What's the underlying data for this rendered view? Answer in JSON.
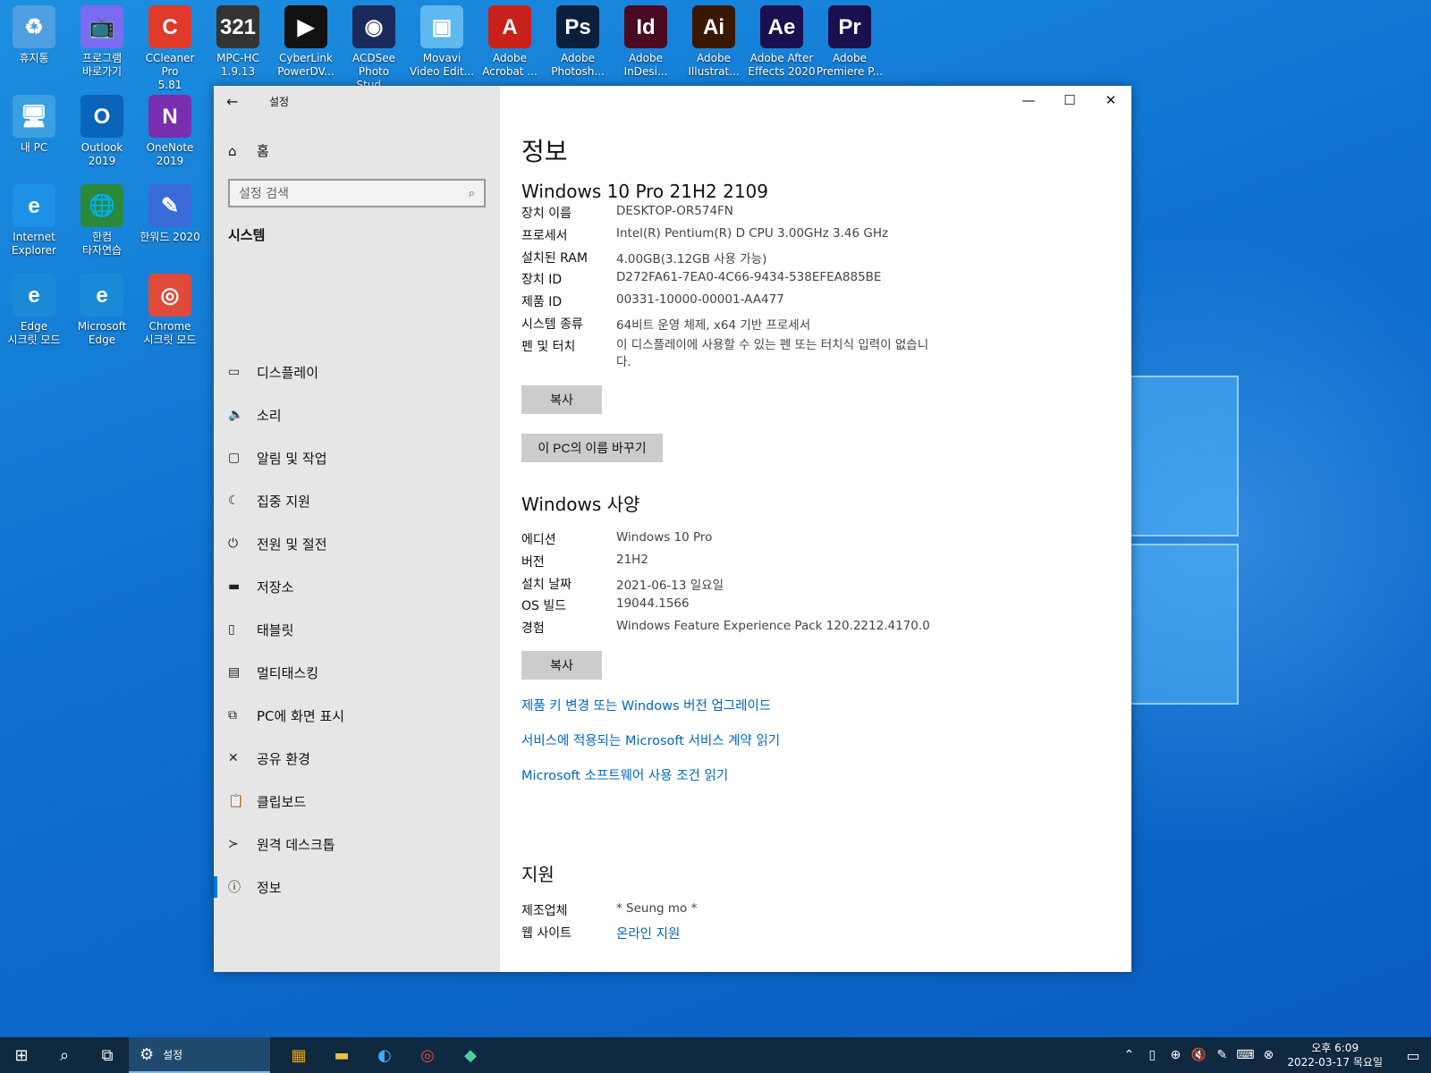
{
  "desktop": {
    "icons": [
      {
        "label": "휴지통",
        "icon": "recycle-bin-icon",
        "color": "#4f9fe0",
        "glyph": "♻"
      },
      {
        "label": "프로그램\n바로가기",
        "icon": "tv-icon",
        "color": "#7a6cf0",
        "glyph": "📺"
      },
      {
        "label": "CCleaner Pro\n5.81",
        "icon": "ccleaner-icon",
        "color": "#e03a2a",
        "glyph": "C"
      },
      {
        "label": "MPC-HC\n1.9.13",
        "icon": "mpc-hc-icon",
        "color": "#333333",
        "glyph": "321"
      },
      {
        "label": "CyberLink\nPowerDV...",
        "icon": "powerdvd-icon",
        "color": "#111111",
        "glyph": "▶"
      },
      {
        "label": "ACDSee\nPhoto Stud...",
        "icon": "acdsee-icon",
        "color": "#1a2a5a",
        "glyph": "◉"
      },
      {
        "label": "Movavi\nVideo Edit...",
        "icon": "movavi-icon",
        "color": "#5fb8f0",
        "glyph": "▣"
      },
      {
        "label": "Adobe\nAcrobat ...",
        "icon": "acrobat-icon",
        "color": "#c8201a",
        "glyph": "A"
      },
      {
        "label": "Adobe\nPhotosh...",
        "icon": "photoshop-icon",
        "color": "#0a1f3c",
        "glyph": "Ps"
      },
      {
        "label": "Adobe\nInDesi...",
        "icon": "indesign-icon",
        "color": "#4a0a22",
        "glyph": "Id"
      },
      {
        "label": "Adobe\nIllustrat...",
        "icon": "illustrator-icon",
        "color": "#3a1800",
        "glyph": "Ai"
      },
      {
        "label": "Adobe After\nEffects 2020",
        "icon": "after-effects-icon",
        "color": "#1a1050",
        "glyph": "Ae"
      },
      {
        "label": "Adobe\nPremiere P...",
        "icon": "premiere-icon",
        "color": "#1a1050",
        "glyph": "Pr"
      },
      {
        "label": "내 PC",
        "icon": "this-pc-icon",
        "color": "#3aa0e0",
        "glyph": "🖥"
      },
      {
        "label": "Outlook\n2019",
        "icon": "outlook-icon",
        "color": "#0a64b8",
        "glyph": "O"
      },
      {
        "label": "OneNote\n2019",
        "icon": "onenote-icon",
        "color": "#7a2fb0",
        "glyph": "N"
      },
      {
        "label": "Internet\nExplorer",
        "icon": "internet-explorer-icon",
        "color": "#1e90e8",
        "glyph": "e"
      },
      {
        "label": "한컴\n타자연습",
        "icon": "hancom-typing-icon",
        "color": "#2a8a3a",
        "glyph": "🌐"
      },
      {
        "label": "한워드 2020",
        "icon": "hanword-icon",
        "color": "#3a6ad8",
        "glyph": "✎"
      },
      {
        "label": "Edge\n시크릿 모드",
        "icon": "edge-incognito-icon",
        "color": "#1a8ad8",
        "glyph": "e"
      },
      {
        "label": "Microsoft\nEdge",
        "icon": "edge-icon",
        "color": "#1a8ad8",
        "glyph": "e"
      },
      {
        "label": "Chrome\n시크릿 모드",
        "icon": "chrome-incognito-icon",
        "color": "#e04a3a",
        "glyph": "◎"
      }
    ]
  },
  "window": {
    "title": "설정",
    "controls": {
      "minimize": "—",
      "maximize": "☐",
      "close": "✕"
    }
  },
  "sidebar": {
    "home_label": "홈",
    "search_placeholder": "설정 검색",
    "section": "시스템",
    "items": [
      {
        "label": "디스플레이",
        "glyph": "▭"
      },
      {
        "label": "소리",
        "glyph": "🔈"
      },
      {
        "label": "알림 및 작업",
        "glyph": "▢"
      },
      {
        "label": "집중 지원",
        "glyph": "☾"
      },
      {
        "label": "전원 및 절전",
        "glyph": "⏻"
      },
      {
        "label": "저장소",
        "glyph": "▬"
      },
      {
        "label": "태블릿",
        "glyph": "▯"
      },
      {
        "label": "멀티태스킹",
        "glyph": "▤"
      },
      {
        "label": "PC에 화면 표시",
        "glyph": "⧉"
      },
      {
        "label": "공유 환경",
        "glyph": "✕"
      },
      {
        "label": "클립보드",
        "glyph": "📋"
      },
      {
        "label": "원격 데스크톱",
        "glyph": "≻"
      },
      {
        "label": "정보",
        "glyph": "ⓘ"
      }
    ],
    "active_index": 12
  },
  "content": {
    "title": "정보",
    "device_heading": "Windows 10 Pro 21H2 2109",
    "device_specs": [
      {
        "key": "장치 이름",
        "value": "DESKTOP-OR574FN"
      },
      {
        "key": "프로세서",
        "value": "Intel(R) Pentium(R) D CPU 3.00GHz   3.46 GHz"
      },
      {
        "key": "설치된 RAM",
        "value": "4.00GB(3.12GB 사용 가능)"
      },
      {
        "key": "장치 ID",
        "value": "D272FA61-7EA0-4C66-9434-538EFEA885BE"
      },
      {
        "key": "제품 ID",
        "value": "00331-10000-00001-AA477"
      },
      {
        "key": "시스템 종류",
        "value": "64비트 운영 체제, x64 기반 프로세서"
      },
      {
        "key": "펜 및 터치",
        "value": "이 디스플레이에 사용할 수 있는 펜 또는 터치식 입력이 없습니다."
      }
    ],
    "copy_label": "복사",
    "rename_label": "이 PC의 이름 바꾸기",
    "windows_heading": "Windows 사양",
    "windows_specs": [
      {
        "key": "에디션",
        "value": "Windows 10 Pro"
      },
      {
        "key": "버전",
        "value": "21H2"
      },
      {
        "key": "설치 날짜",
        "value": "2021-06-13 일요일"
      },
      {
        "key": "OS 빌드",
        "value": "19044.1566"
      },
      {
        "key": "경험",
        "value": "Windows Feature Experience Pack 120.2212.4170.0"
      }
    ],
    "copy_label_2": "복사",
    "links": [
      "제품 키 변경 또는 Windows 버전 업그레이드",
      "서비스에 적용되는 Microsoft 서비스 계약 읽기",
      "Microsoft 소프트웨어 사용 조건 읽기"
    ],
    "support_heading": "지원",
    "support": [
      {
        "key": "제조업체",
        "value": "* Seung mo *"
      },
      {
        "key": "웹 사이트",
        "value": "온라인 지원"
      }
    ]
  },
  "taskbar": {
    "active_app_label": "설정",
    "clock_time": "오후 6:09",
    "clock_date": "2022-03-17 목요일"
  },
  "colors": {
    "accent": "#0078d7",
    "link": "#0067c0",
    "taskbar": "#0f2940"
  }
}
